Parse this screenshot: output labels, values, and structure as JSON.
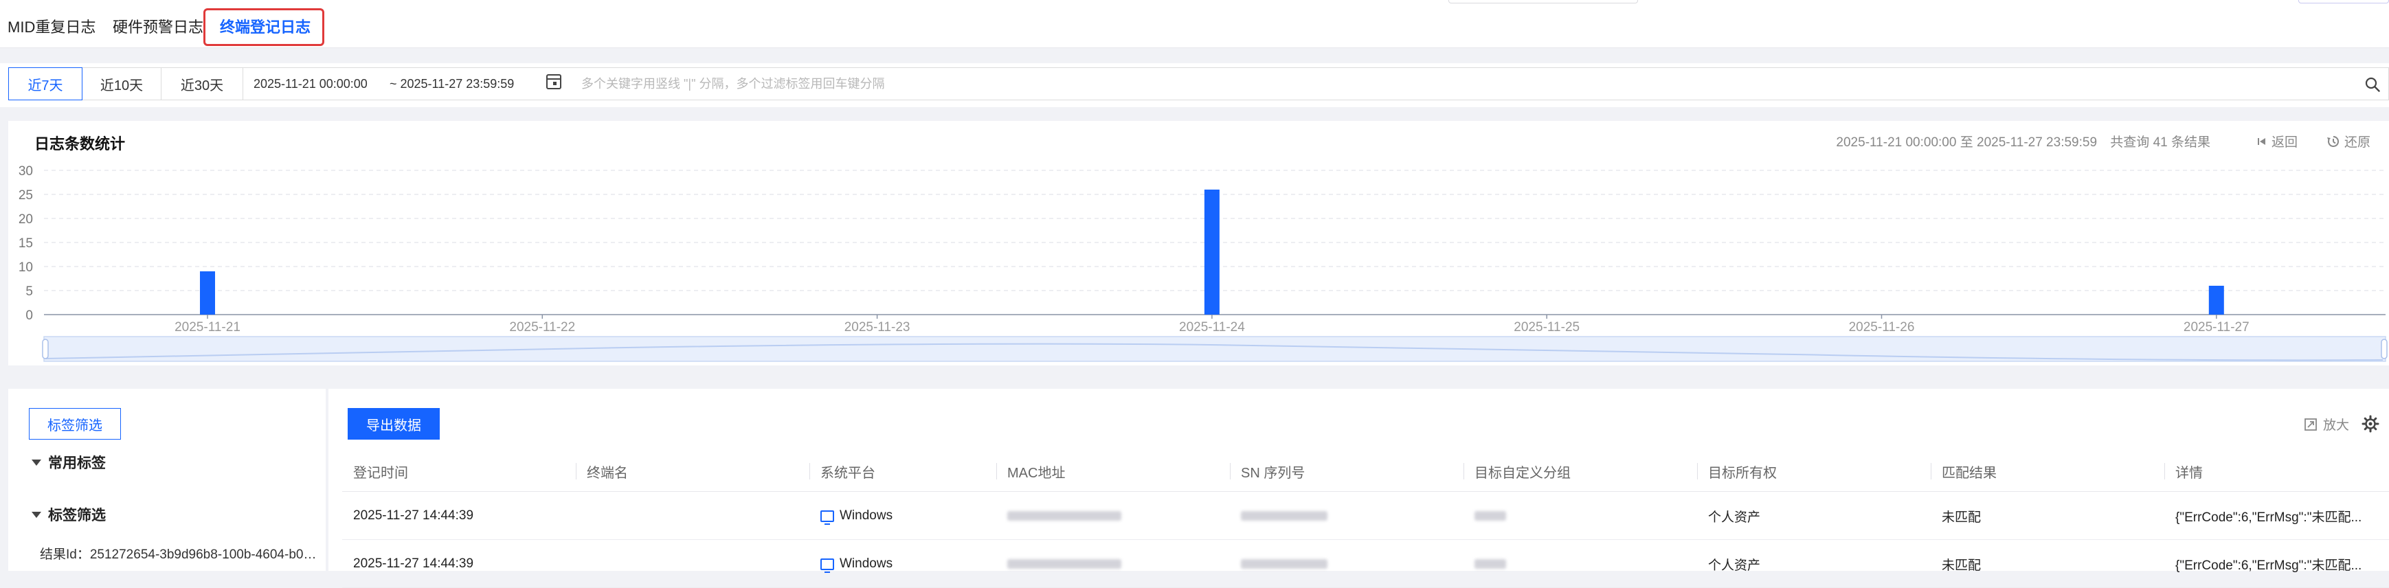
{
  "tabs": [
    {
      "label": "MID重复日志",
      "active": false
    },
    {
      "label": "硬件预警日志",
      "active": false
    },
    {
      "label": "终端登记日志",
      "active": true
    }
  ],
  "filters": {
    "ranges": [
      "近7天",
      "近10天",
      "近30天"
    ],
    "active_range": "近7天",
    "start_date": "2025-11-21 00:00:00",
    "end_date": "~ 2025-11-27 23:59:59",
    "search_placeholder": "多个关键字用竖线 \"|\" 分隔，多个过滤标签用回车键分隔"
  },
  "chart_panel": {
    "title": "日志条数统计",
    "summary_range": "2025-11-21 00:00:00 至 2025-11-27 23:59:59",
    "summary_count": "共查询 41 条结果",
    "back_label": "返回",
    "restore_label": "还原"
  },
  "chart_data": {
    "type": "bar",
    "categories": [
      "2025-11-21",
      "2025-11-22",
      "2025-11-23",
      "2025-11-24",
      "2025-11-25",
      "2025-11-26",
      "2025-11-27"
    ],
    "values": [
      9,
      0,
      0,
      26,
      0,
      0,
      6
    ],
    "yticks": [
      0,
      5,
      10,
      15,
      20,
      25,
      30
    ],
    "ylim": [
      0,
      30
    ],
    "grid": true,
    "bar_color": "#1664ff",
    "title": "",
    "xlabel": "",
    "ylabel": ""
  },
  "tag_panel": {
    "button_label": "标签筛选",
    "groups": [
      "常用标签",
      "标签筛选"
    ],
    "result_text": "结果Id：251272654-3b9d96b8-100b-4604-b0b9..."
  },
  "table": {
    "export_label": "导出数据",
    "zoom_label": "放大",
    "columns": [
      "登记时间",
      "终端名",
      "系统平台",
      "MAC地址",
      "SN 序列号",
      "目标自定义分组",
      "目标所有权",
      "匹配结果",
      "详情"
    ],
    "rows": [
      {
        "time": "2025-11-27 14:44:39",
        "platform": "Windows",
        "ownership": "个人资产",
        "match": "未匹配",
        "detail": "{\"ErrCode\":6,\"ErrMsg\":\"未匹配..."
      },
      {
        "time": "2025-11-27 14:44:39",
        "platform": "Windows",
        "ownership": "个人资产",
        "match": "未匹配",
        "detail": "{\"ErrCode\":6,\"ErrMsg\":\"未匹配..."
      }
    ]
  },
  "colors": {
    "accent": "#1664ff",
    "highlight_box": "#e03a3a"
  }
}
